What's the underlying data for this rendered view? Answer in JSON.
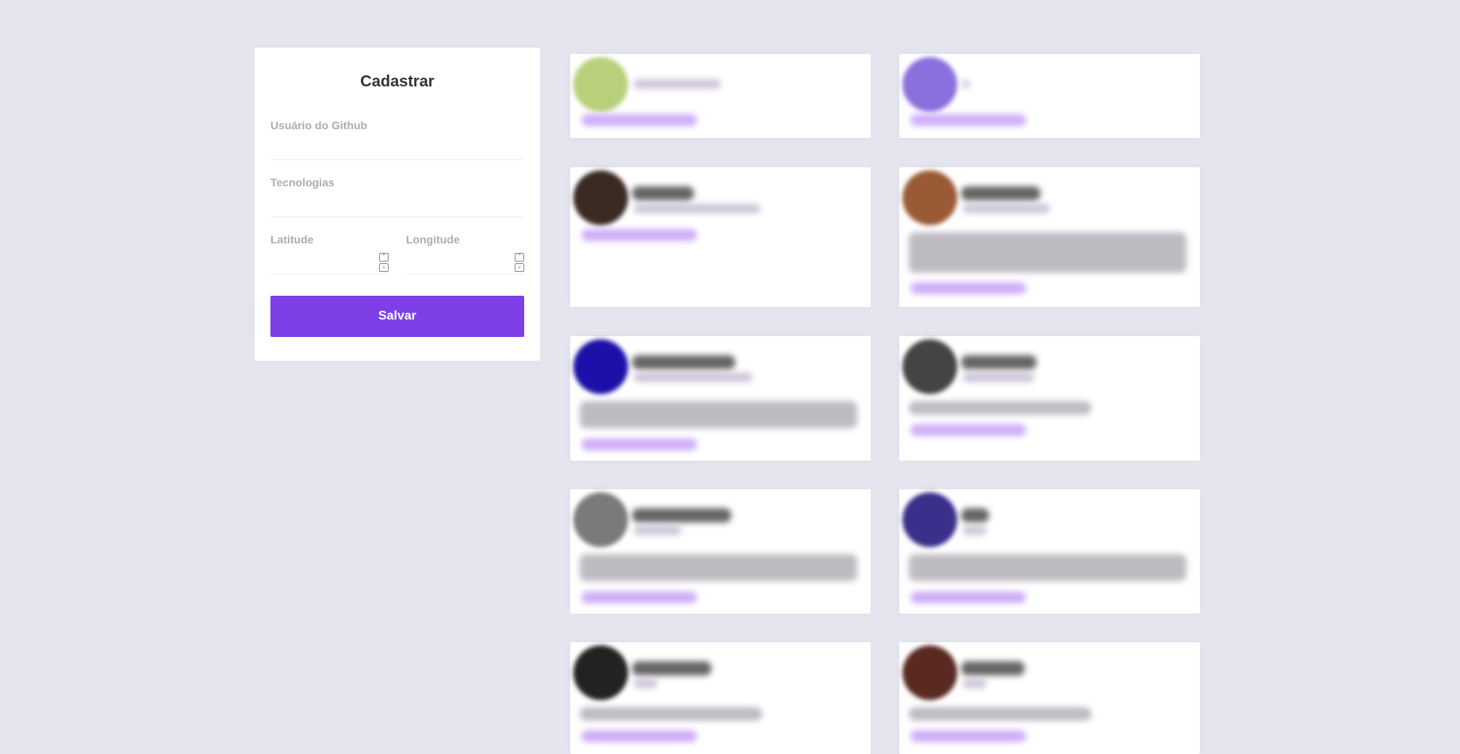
{
  "form": {
    "title": "Cadastrar",
    "github_username_label": "Usuário do Github",
    "github_username_value": "",
    "techs_label": "Tecnologias",
    "techs_value": "",
    "latitude_label": "Latitude",
    "latitude_value": "",
    "longitude_label": "Longitude",
    "longitude_value": "",
    "save_label": "Salvar",
    "button_color": "#7d40e7"
  },
  "devs": [
    {
      "avatar_color": "#b9d07a"
    },
    {
      "avatar_color": "#8b6fdc"
    },
    {
      "avatar_color": "#3a2a24"
    },
    {
      "avatar_color": "#9a5a35"
    },
    {
      "avatar_color": "#1d10a8"
    },
    {
      "avatar_color": "#444444"
    },
    {
      "avatar_color": "#7a7a78"
    },
    {
      "avatar_color": "#3a2f8a"
    },
    {
      "avatar_color": "#222222"
    },
    {
      "avatar_color": "#5a2a22"
    }
  ]
}
